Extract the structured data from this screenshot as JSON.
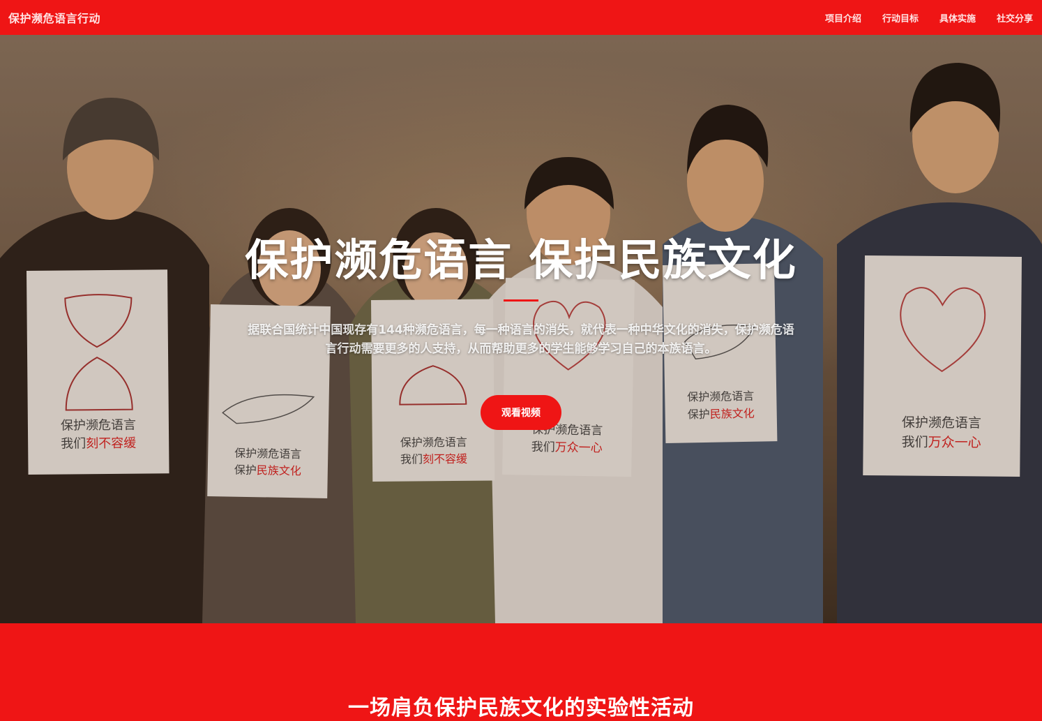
{
  "navbar": {
    "brand": "保护濒危语言行动",
    "links": [
      "项目介绍",
      "行动目标",
      "具体实施",
      "社交分享"
    ]
  },
  "hero": {
    "title": "保护濒危语言 保护民族文化",
    "description": "据联合国统计中国现存有144种濒危语言，每一种语言的消失，就代表一种中华文化的消失，保护濒危语言行动需要更多的人支持，从而帮助更多的学生能够学习自己的本族语言。",
    "button_label": "观看视频",
    "posters": [
      {
        "line1": "保护濒危语言",
        "line2_prefix": "我们",
        "line2_accent": "刻不容缓"
      },
      {
        "line1": "保护濒危语言",
        "line2_prefix": "保护",
        "line2_accent": "民族文化"
      },
      {
        "line1": "保护濒危语言",
        "line2_prefix": "我们",
        "line2_accent": "刻不容缓"
      },
      {
        "line1": "保护濒危语言",
        "line2_prefix": "我们",
        "line2_accent": "万众一心"
      },
      {
        "line1": "保护濒危语言",
        "line2_prefix": "保护",
        "line2_accent": "民族文化"
      },
      {
        "line1": "保护濒危语言",
        "line2_prefix": "我们",
        "line2_accent": "万众一心"
      }
    ]
  },
  "section": {
    "title": "一场肩负保护民族文化的实验性活动"
  },
  "colors": {
    "brand_red": "#ef1515",
    "nav_text": "#ffe4e4",
    "hero_text": "#ffffff"
  }
}
